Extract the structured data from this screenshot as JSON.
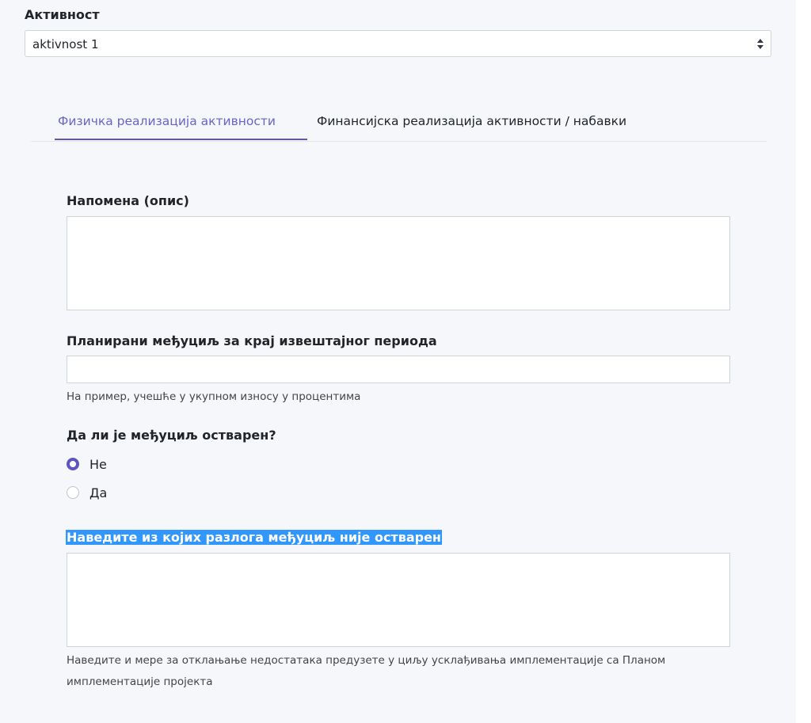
{
  "activity": {
    "label": "Активност",
    "selected": "aktivnost 1"
  },
  "tabs": [
    {
      "label": "Физичка реализација активности",
      "active": true
    },
    {
      "label": "Финансијска реализација активности / набавки",
      "active": false
    }
  ],
  "form": {
    "note_label": "Напомена (опис)",
    "note_value": "",
    "milestone_label": "Планирани међуциљ за крај извештајног периода",
    "milestone_value": "",
    "milestone_help": "На пример, учешће у укупном износу у процентима",
    "achieved_label": "Да ли је међуциљ остварен?",
    "achieved_options": [
      {
        "label": "Не",
        "checked": true
      },
      {
        "label": "Да",
        "checked": false
      }
    ],
    "reason_label": "Наведите из којих разлога међуциљ није остварен",
    "reason_value": "",
    "reason_help": "Наведите и мере за отклањање недостатака предузете у циљу усклађивања имплементације са Планом имплементације пројекта"
  },
  "colors": {
    "accent": "#5f55c0",
    "selection": "#3297fd",
    "panel_bg": "#f5f7fa"
  }
}
